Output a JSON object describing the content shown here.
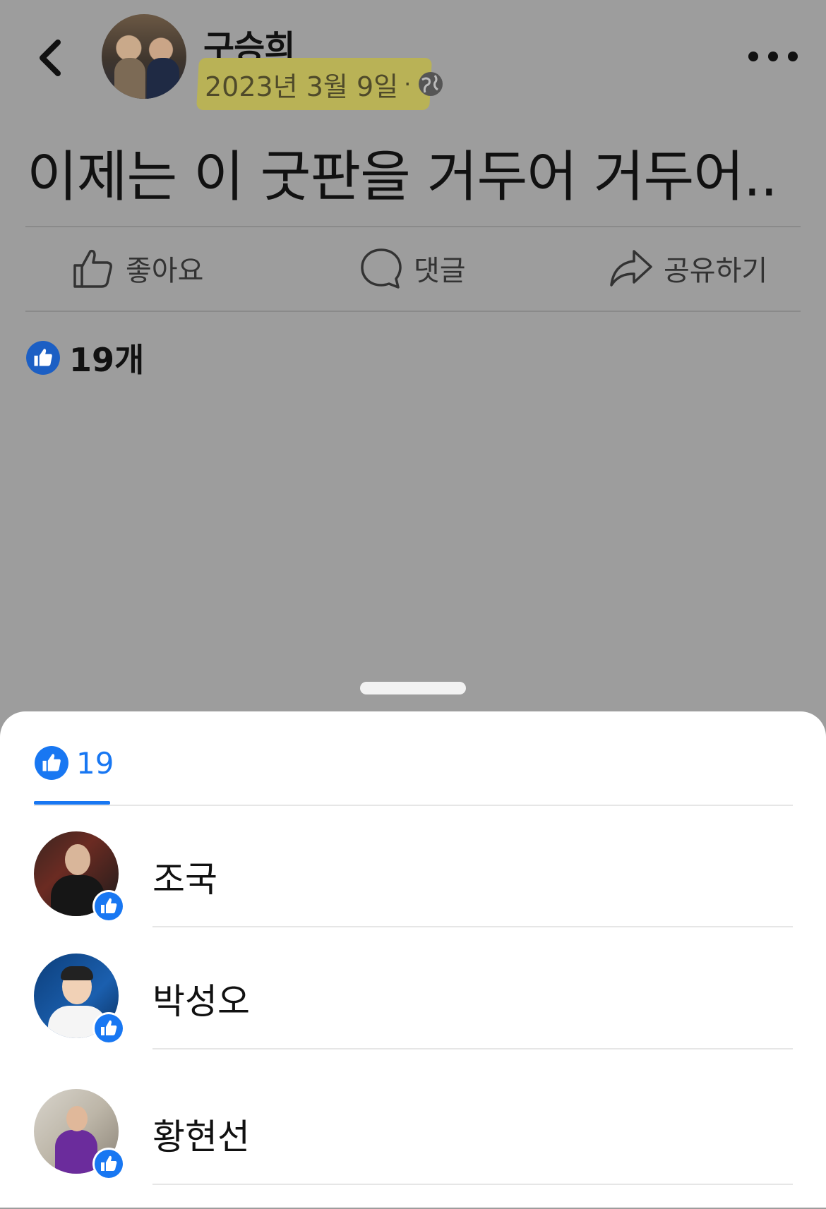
{
  "post": {
    "author": "구승희",
    "date": "2023년 3월 9일",
    "separator": "·",
    "privacy_icon": "globe-icon",
    "text": "이제는 이 굿판을 거두어 거두어..",
    "like_summary": "19개"
  },
  "actions": {
    "like_label": "좋아요",
    "comment_label": "댓글",
    "share_label": "공유하기"
  },
  "reactions_sheet": {
    "tab_count": "19",
    "people": [
      {
        "name": "조국"
      },
      {
        "name": "박성오"
      },
      {
        "name": "황현선"
      }
    ]
  },
  "colors": {
    "facebook_blue": "#1877f2",
    "highlight": "#b9b256",
    "backdrop": "#9d9d9d"
  }
}
